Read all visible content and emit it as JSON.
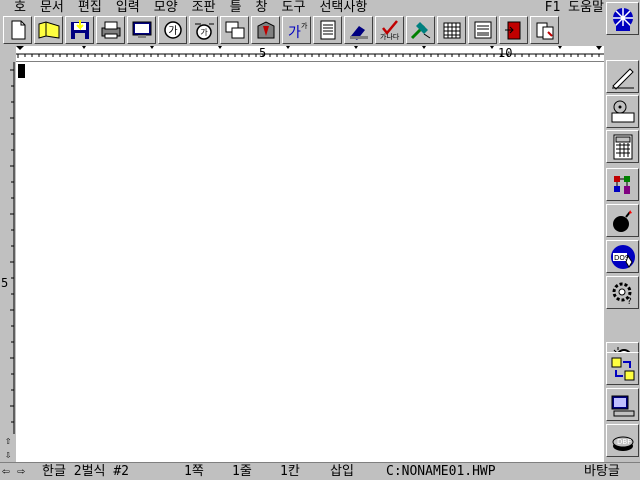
{
  "menu": {
    "items": [
      "호",
      "문서",
      "편집",
      "입력",
      "모양",
      "조판",
      "틀",
      "창",
      "도구",
      "선택사항"
    ],
    "help": "F1 도움말"
  },
  "toolbar": {
    "buttons": [
      "new-doc-icon",
      "open-folder-icon",
      "save-disk-icon",
      "print-icon",
      "screen-view-icon",
      "char-shape-icon",
      "para-shape-icon",
      "copy-format-icon",
      "style-icon",
      "spell-special-icon",
      "outline-icon",
      "stamp-icon",
      "spell-check-icon",
      "draw-icon",
      "table-icon",
      "form-icon",
      "exit-icon",
      "clipboard-icon"
    ]
  },
  "ruler": {
    "labels": [
      "5",
      "10"
    ]
  },
  "vruler": {
    "label": "5"
  },
  "rightbar": {
    "buttons": [
      "globe-icon",
      "pen-icon",
      "cd-drive-icon",
      "calculator-icon",
      "puzzle-icon",
      "bomb-icon",
      "dos-icon",
      "settings-icon",
      "search-icon",
      "transfer-icon",
      "computer-icon",
      "database-icon"
    ]
  },
  "status": {
    "font_mode": "한글 2벌식 #2",
    "page": "1쪽",
    "line": "1줄",
    "column": "1칸",
    "insert_mode": "삽입",
    "filename": "C:NONAME01.HWP",
    "font_name": "바탕글"
  }
}
